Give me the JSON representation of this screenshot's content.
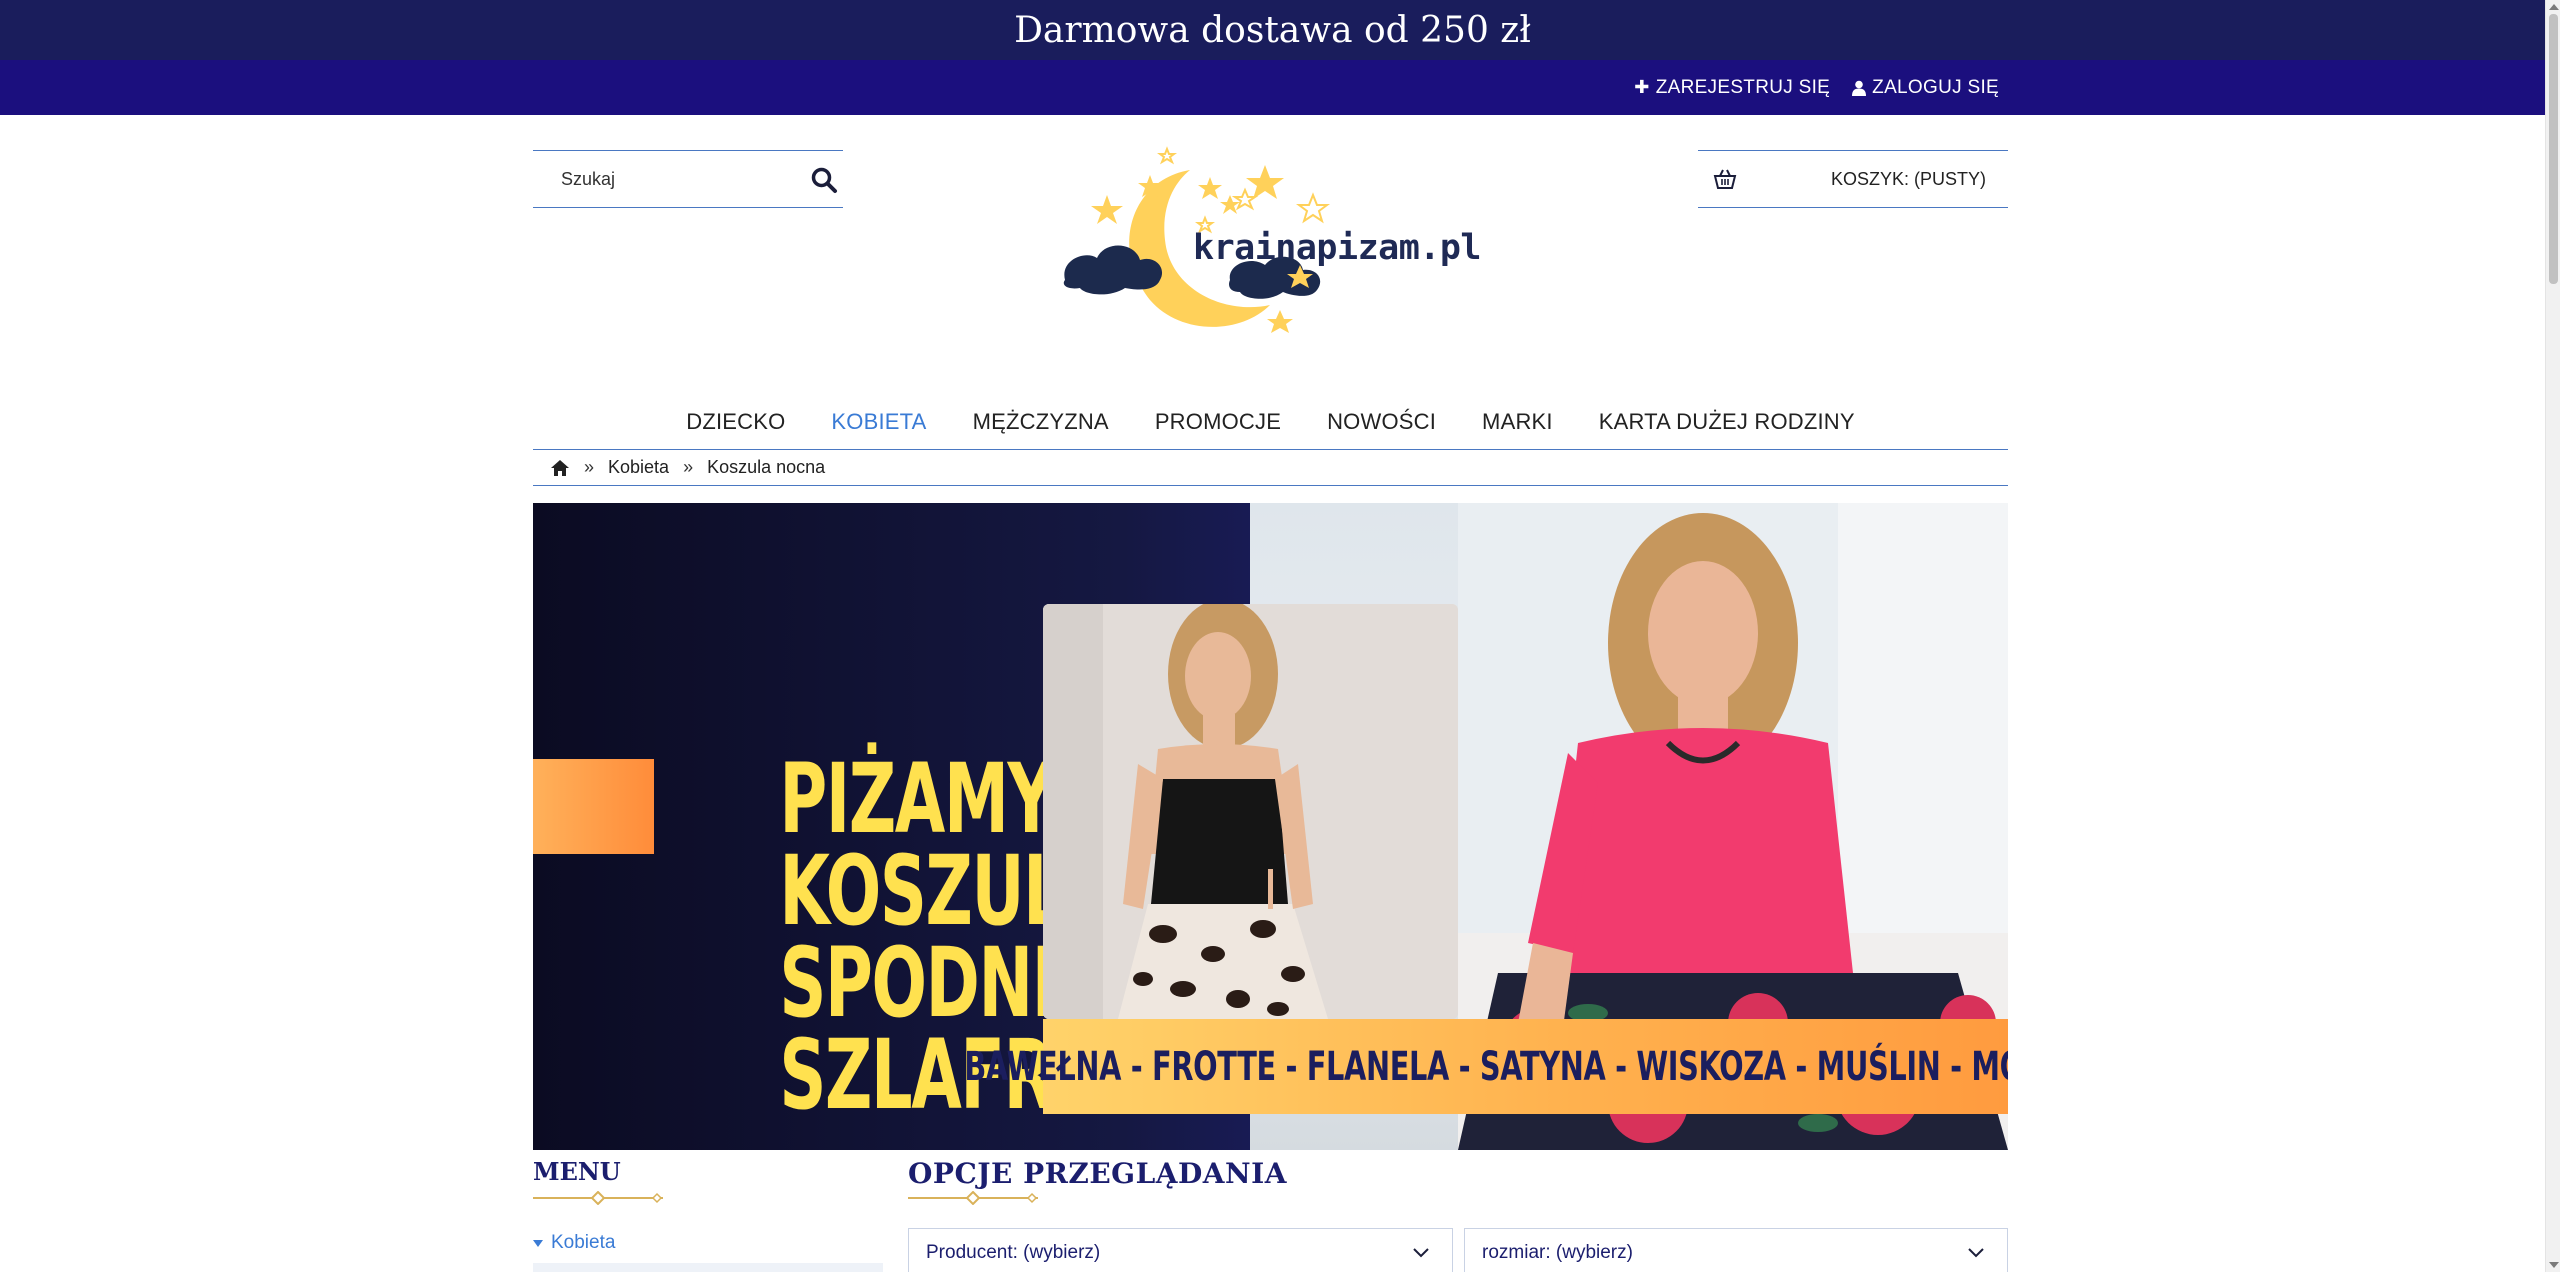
{
  "promo": {
    "text": "Darmowa dostawa od 250 zł"
  },
  "account": {
    "register_label": "ZAREJESTRUJ SIĘ",
    "login_label": "ZALOGUJ SIĘ"
  },
  "search": {
    "placeholder": "Szukaj"
  },
  "cart": {
    "label": "KOSZYK: (PUSTY)"
  },
  "logo": {
    "text": "krainapizam.pl"
  },
  "nav": {
    "items": [
      "DZIECKO",
      "KOBIETA",
      "MĘŻCZYZNA",
      "PROMOCJE",
      "NOWOŚCI",
      "MARKI",
      "KARTA DUŻEJ RODZINY"
    ],
    "active": "KOBIETA"
  },
  "breadcrumb": {
    "separator": "»",
    "items": [
      "Kobieta",
      "Koszula nocna"
    ]
  },
  "hero": {
    "headline": [
      "PIŻAMY",
      "KOSZULE",
      "SPODNIE",
      "SZLAFROKI"
    ],
    "fabrics": "BAWEŁNA - FROTTE - FLANELA - SATYNA - WISKOZA - MUŚLIN - MODAL"
  },
  "sidebar": {
    "heading": "MENU",
    "items": [
      "Kobieta"
    ]
  },
  "options": {
    "heading": "OPCJE PRZEGLĄDANIA",
    "producer": "Producent: (wybierz)",
    "size": "rozmiar: (wybierz)"
  },
  "colors": {
    "promo_bg": "#1a1d5c",
    "account_bg": "#1b0f7e",
    "accent_blue": "#3a7bd5",
    "heading_navy": "#1b1e6e",
    "banner_yellow": "#ffe14f",
    "banner_orange": "#ff9b3f"
  }
}
